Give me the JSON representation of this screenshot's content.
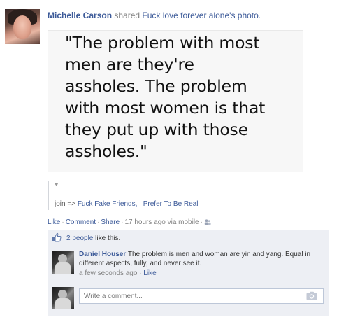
{
  "post": {
    "actor": "Michelle Carson",
    "verb": "shared",
    "shared_from": "Fuck love forever alone's photo.",
    "quote_lines": [
      "\"The problem with most",
      "men are they're",
      "assholes. The problem",
      "with most women is that",
      "they put up with those",
      "assholes.\""
    ],
    "heart": "♥",
    "share_prefix": "join =>",
    "share_link": "Fuck Fake Friends, I Prefer To Be Real"
  },
  "actions": {
    "like": "Like",
    "comment": "Comment",
    "share": "Share",
    "timestamp": "17 hours ago via mobile"
  },
  "likes": {
    "count_link": "2 people",
    "suffix": "like this."
  },
  "comment": {
    "author": "Daniel Houser",
    "text": "The problem is men and woman are yin and yang. Equal in different aspects, fully, and never see it.",
    "time": "a few seconds ago",
    "like": "Like"
  },
  "compose": {
    "placeholder": "Write a comment..."
  },
  "colors": {
    "link": "#3b5998",
    "ufi_bg": "#edeff4",
    "meta": "#808080"
  },
  "icons": [
    "heart-icon",
    "like-thumb-icon",
    "people-icon",
    "camera-icon"
  ]
}
